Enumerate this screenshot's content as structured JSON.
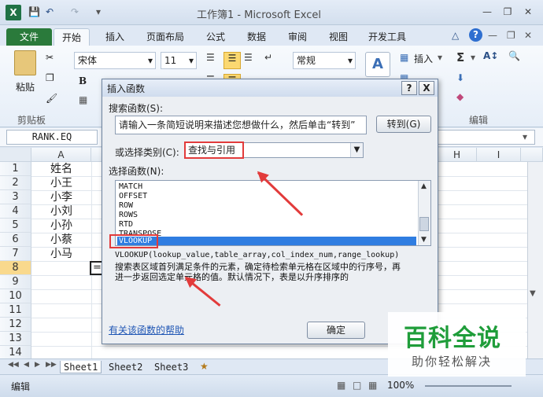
{
  "window": {
    "title": "工作簿1 - Microsoft Excel",
    "app_icon": "X"
  },
  "ribbon_tabs": [
    "文件",
    "开始",
    "插入",
    "页面布局",
    "公式",
    "数据",
    "审阅",
    "视图",
    "开发工具"
  ],
  "ribbon": {
    "paste": "粘贴",
    "clipboard_group": "剪贴板",
    "font_name": "宋体",
    "font_size": "11",
    "bold": "B",
    "number_format": "常规",
    "insert": "插入",
    "sigma": "Σ",
    "edit_group": "编辑"
  },
  "formula_bar": {
    "name_box": "RANK.EQ"
  },
  "grid": {
    "columns": [
      "A",
      "H",
      "I"
    ],
    "rows": [
      "1",
      "2",
      "3",
      "4",
      "5",
      "6",
      "7",
      "8",
      "9",
      "10",
      "11",
      "12",
      "13",
      "14"
    ],
    "cells_a": [
      "姓名",
      "小王",
      "小李",
      "小刘",
      "小孙",
      "小蔡",
      "小马"
    ],
    "active_cell_text": "="
  },
  "sheets": [
    "Sheet1",
    "Sheet2",
    "Sheet3"
  ],
  "status": {
    "mode": "编辑",
    "zoom": "100%"
  },
  "dialog": {
    "title": "插入函数",
    "help_btn": "?",
    "close_btn": "X",
    "search_label": "搜索函数(S):",
    "search_text": "请输入一条简短说明来描述您想做什么，然后单击“转到”",
    "go_btn": "转到(G)",
    "category_label": "或选择类别(C):",
    "category_value": "查找与引用",
    "function_label": "选择函数(N):",
    "functions": [
      "MATCH",
      "OFFSET",
      "ROW",
      "ROWS",
      "RTD",
      "TRANSPOSE",
      "VLOOKUP"
    ],
    "selected_function": "VLOOKUP",
    "signature": "VLOOKUP(lookup_value,table_array,col_index_num,range_lookup)",
    "description_line1": "搜索表区域首列满足条件的元素，确定待检索单元格在区域中的行序号，再",
    "description_line2": "进一步返回选定单元格的值。默认情况下，表是以升序排序的",
    "help_link": "有关该函数的帮助",
    "ok_btn": "确定"
  },
  "watermark": {
    "brand": "百科全说",
    "slogan": "助你轻松解决"
  },
  "colors": {
    "file_tab": "#2a7a3b",
    "selection": "#2f7de1",
    "highlight_red": "#e23b3b",
    "watermark_green": "#1f9d3a"
  }
}
